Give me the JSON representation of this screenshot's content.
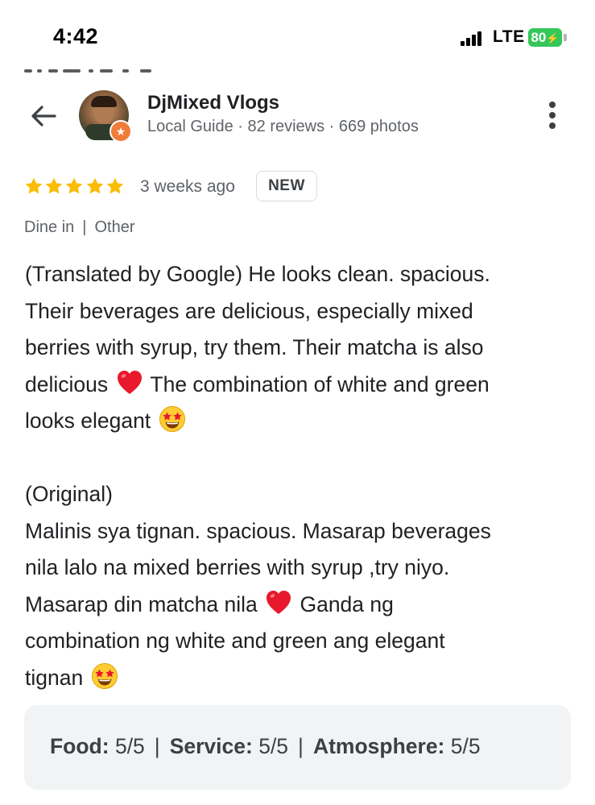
{
  "status_bar": {
    "time": "4:42",
    "network": "LTE",
    "battery": "80"
  },
  "author": {
    "name": "DjMixed Vlogs",
    "meta": "Local Guide · 82 reviews · 669 photos"
  },
  "review": {
    "rating": 5,
    "max_rating": 5,
    "time_ago": "3 weeks ago",
    "new_label": "NEW",
    "tags": [
      "Dine in",
      "Other"
    ],
    "translated_lines": [
      "(Translated by Google) He looks clean. spacious.",
      "Their beverages are delicious, especially mixed",
      "berries with syrup, try them. Their matcha is also"
    ],
    "translated_line4_a": "delicious",
    "translated_line4_b": "The combination of white and green",
    "translated_line5": "looks elegant",
    "original_label": "(Original)",
    "original_lines": [
      "Malinis sya tignan. spacious. Masarap beverages",
      "nila lalo na mixed berries with syrup ,try niyo."
    ],
    "original_line3_a": "Masarap din matcha nila",
    "original_line3_b": "Ganda ng",
    "original_line4": "combination ng white and green ang elegant",
    "original_line5": "tignan"
  },
  "ratings": {
    "food_label": "Food:",
    "food_value": "5/5",
    "service_label": "Service:",
    "service_value": "5/5",
    "atmosphere_label": "Atmosphere:",
    "atmosphere_value": "5/5"
  },
  "colors": {
    "star": "#fbbc04",
    "text_primary": "#202124",
    "text_secondary": "#5f6368",
    "battery": "#34c759",
    "guide_badge": "#f07c3a",
    "ratings_bg": "#f1f3f4"
  }
}
